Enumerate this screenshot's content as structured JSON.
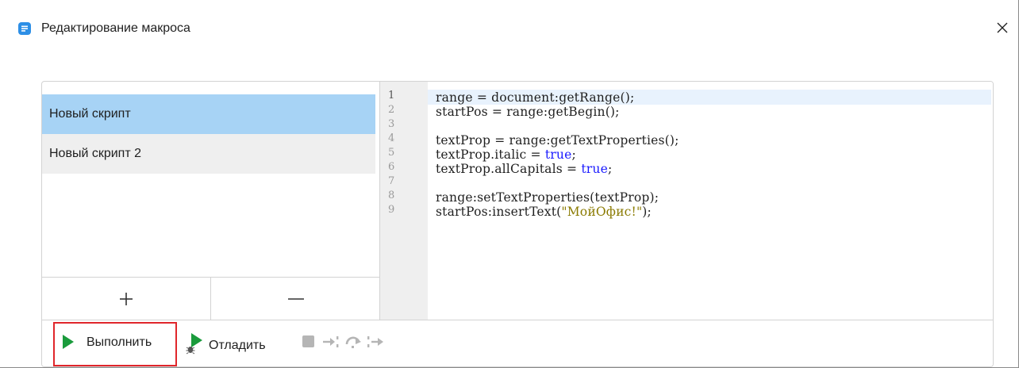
{
  "window": {
    "title": "Редактирование макроса",
    "icon": "app-icon",
    "close_icon": "close-icon"
  },
  "scripts": {
    "items": [
      {
        "label": "Новый скрипт",
        "selected": true
      },
      {
        "label": "Новый скрипт 2",
        "selected": false
      }
    ],
    "add_label": "+",
    "remove_label": "—"
  },
  "editor": {
    "line_numbers": [
      "1",
      "2",
      "3",
      "4",
      "5",
      "6",
      "7",
      "8",
      "9"
    ],
    "lines": [
      [
        {
          "t": "range = document:getRange();",
          "c": ""
        }
      ],
      [
        {
          "t": "startPos = range:getBegin();",
          "c": ""
        }
      ],
      [
        {
          "t": "",
          "c": ""
        }
      ],
      [
        {
          "t": "textProp = range:getTextProperties();",
          "c": ""
        }
      ],
      [
        {
          "t": "textProp.italic = ",
          "c": ""
        },
        {
          "t": "true",
          "c": "kw"
        },
        {
          "t": ";",
          "c": ""
        }
      ],
      [
        {
          "t": "textProp.allCapitals = ",
          "c": ""
        },
        {
          "t": "true",
          "c": "kw"
        },
        {
          "t": ";",
          "c": ""
        }
      ],
      [
        {
          "t": "",
          "c": ""
        }
      ],
      [
        {
          "t": "range:setTextProperties(textProp);",
          "c": ""
        }
      ],
      [
        {
          "t": "startPos:insertText(",
          "c": ""
        },
        {
          "t": "\"МойОфис!\"",
          "c": "str"
        },
        {
          "t": ");",
          "c": ""
        }
      ]
    ]
  },
  "toolbar": {
    "run_label": "Выполнить",
    "debug_label": "Отладить",
    "icons": [
      "play-icon",
      "debug-icon",
      "stop-icon",
      "step-into-icon",
      "step-over-icon",
      "step-out-icon"
    ]
  },
  "colors": {
    "selected_bg": "#a7d3f5",
    "run_green": "#1a9b3c",
    "highlight_border": "#e0262b",
    "keyword": "#1a1aff",
    "string": "#8a7a00"
  }
}
